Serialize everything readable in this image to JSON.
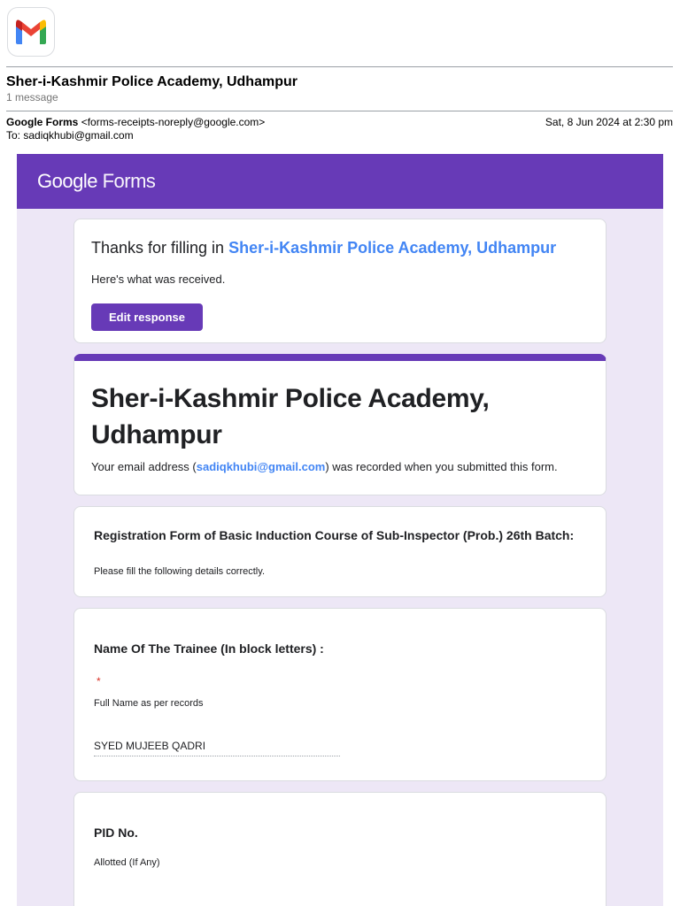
{
  "email": {
    "subject": "Sher-i-Kashmir Police Academy, Udhampur",
    "message_count": "1 message",
    "from_name": "Google Forms",
    "from_address": "<forms-receipts-noreply@google.com>",
    "to": "To: sadiqkhubi@gmail.com",
    "date": "Sat, 8 Jun 2024 at 2:30 pm"
  },
  "banner": {
    "google": "Google",
    "forms": "Forms"
  },
  "thanks_card": {
    "prefix": "Thanks for filling in ",
    "form_link": "Sher-i-Kashmir Police Academy, Udhampur",
    "received": "Here's what was received.",
    "edit_label": "Edit response"
  },
  "title_card": {
    "title": "Sher-i-Kashmir Police Academy, Udhampur",
    "email_prefix": "Your email address (",
    "email": "sadiqkhubi@gmail.com",
    "email_suffix": ") was recorded when you submitted this form."
  },
  "section": {
    "title": "Registration Form of Basic Induction Course  of Sub-Inspector (Prob.)  26th Batch:",
    "description": "Please fill the following details correctly."
  },
  "questions": [
    {
      "title": "Name Of The Trainee (In block letters) :",
      "required_mark": "*",
      "help": "Full Name as per records",
      "answer": "SYED MUJEEB QADRI"
    },
    {
      "title": "PID No.",
      "help": "Allotted (If Any)"
    }
  ],
  "colors": {
    "brand_purple": "#673ab7",
    "canvas_lavender": "#ede7f6",
    "link_blue": "#4285f4",
    "required_red": "#d93025"
  },
  "icons": {
    "gmail": "gmail-logo-icon"
  }
}
